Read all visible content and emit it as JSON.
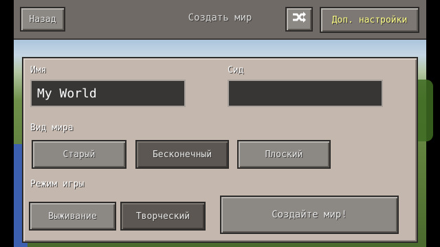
{
  "toolbar": {
    "back_label": "Назад",
    "title": "Создать мир",
    "advanced_label": "Доп. настройки",
    "icon": "shuffle-icon"
  },
  "form": {
    "name_label": "Имя",
    "name_value": "My World",
    "seed_label": "Сид",
    "seed_value": ""
  },
  "world_type": {
    "label": "Вид мира",
    "options": [
      "Старый",
      "Бесконечный",
      "Плоский"
    ],
    "selected": "Бесконечный"
  },
  "game_mode": {
    "label": "Режим игры",
    "options": [
      "Выживание",
      "Творческий"
    ],
    "selected": "Творческий"
  },
  "create_button": "Создайте мир!",
  "colors": {
    "panel": "#c4b7ad",
    "button": "#8c8884",
    "button_selected": "#5c5752",
    "field": "#373635",
    "advanced_text": "#ffff8a"
  }
}
